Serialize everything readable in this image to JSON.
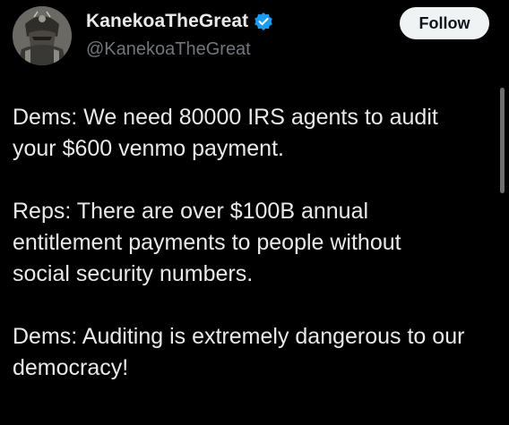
{
  "author": {
    "display_name": "KanekoaTheGreat",
    "handle": "@KanekoaTheGreat",
    "verified_icon": "verified-badge-icon",
    "avatar_icon": "armored-warrior-avatar"
  },
  "follow_button": {
    "label": "Follow"
  },
  "tweet": {
    "paragraphs": [
      {
        "lines": [
          "Dems: We need 80000 IRS agents to audit",
          "your $600 venmo payment."
        ]
      },
      {
        "lines": [
          "Reps: There are over $100B annual",
          "entitlement payments to people without",
          "social security numbers."
        ]
      },
      {
        "lines": [
          "Dems: Auditing is extremely dangerous to our",
          "democracy!"
        ]
      }
    ]
  },
  "colors": {
    "background": "#000000",
    "text": "#e7e9ea",
    "secondary_text": "#71767b",
    "verified": "#1d9bf0",
    "follow_bg": "#eff3f4"
  }
}
